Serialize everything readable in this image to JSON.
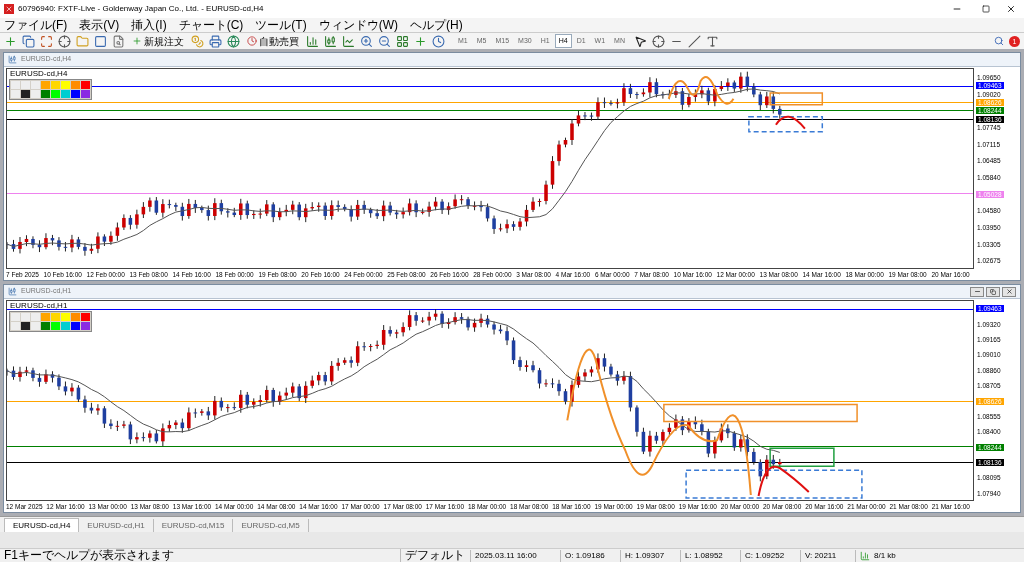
{
  "window": {
    "title": "60796940: FXTF-Live - Goldenway Japan Co., Ltd. - EURUSD-cd,H4"
  },
  "menu": [
    "ファイル(F)",
    "表示(V)",
    "挿入(I)",
    "チャート(C)",
    "ツール(T)",
    "ウィンドウ(W)",
    "ヘルプ(H)"
  ],
  "toolbar": {
    "new_order": "新規注文",
    "auto_trading": "自動売買",
    "notification_badge": "1",
    "timeframes": [
      {
        "label": "M1",
        "selected": false
      },
      {
        "label": "M5",
        "selected": false
      },
      {
        "label": "M15",
        "selected": false
      },
      {
        "label": "M30",
        "selected": false
      },
      {
        "label": "H1",
        "selected": false
      },
      {
        "label": "H4",
        "selected": true
      },
      {
        "label": "D1",
        "selected": false
      },
      {
        "label": "W1",
        "selected": false
      },
      {
        "label": "MN",
        "selected": false
      }
    ]
  },
  "charts": [
    {
      "title": "EURUSD-cd,H4",
      "symbol_label": "EURUSD-cd,H4",
      "window_controls": false,
      "price_ticks": [
        "1.09650",
        "1.09020",
        "1.07745",
        "1.07115",
        "1.06485",
        "1.05840",
        "1.04580",
        "1.03950",
        "1.03305",
        "1.02675"
      ],
      "price_tags": [
        {
          "label": "1.09463",
          "color": "#0000ff"
        },
        {
          "label": "1.08626",
          "color": "#ffa500"
        },
        {
          "label": "1.08244",
          "color": "#008000"
        },
        {
          "label": "1.08136",
          "color": "#000000"
        },
        {
          "label": "1.05028",
          "color": "#ee82ee"
        }
      ],
      "time_labels": [
        "7 Feb 2025",
        "10 Feb 16:00",
        "12 Feb 00:00",
        "13 Feb 08:00",
        "14 Feb 16:00",
        "18 Feb 00:00",
        "19 Feb 08:00",
        "20 Feb 16:00",
        "24 Feb 00:00",
        "25 Feb 08:00",
        "26 Feb 16:00",
        "28 Feb 00:00",
        "3 Mar 08:00",
        "4 Mar 16:00",
        "6 Mar 00:00",
        "7 Mar 08:00",
        "10 Mar 16:00",
        "12 Mar 00:00",
        "13 Mar 08:00",
        "14 Mar 16:00",
        "18 Mar 00:00",
        "19 Mar 08:00",
        "20 Mar 16:00"
      ]
    },
    {
      "title": "EURUSD-cd,H1",
      "symbol_label": "EURUSD-cd,H1",
      "window_controls": true,
      "price_ticks": [
        "1.09320",
        "1.09165",
        "1.09010",
        "1.08860",
        "1.08705",
        "1.08555",
        "1.08400",
        "1.08095",
        "1.07940"
      ],
      "price_tags": [
        {
          "label": "1.09463",
          "color": "#0000ff"
        },
        {
          "label": "1.08626",
          "color": "#ffa500"
        },
        {
          "label": "1.08244",
          "color": "#008000"
        },
        {
          "label": "1.08136",
          "color": "#000000"
        }
      ],
      "time_labels": [
        "12 Mar 2025",
        "12 Mar 16:00",
        "13 Mar 00:00",
        "13 Mar 08:00",
        "13 Mar 16:00",
        "14 Mar 00:00",
        "14 Mar 08:00",
        "14 Mar 16:00",
        "17 Mar 00:00",
        "17 Mar 08:00",
        "17 Mar 16:00",
        "18 Mar 00:00",
        "18 Mar 08:00",
        "18 Mar 16:00",
        "19 Mar 00:00",
        "19 Mar 08:00",
        "19 Mar 16:00",
        "20 Mar 00:00",
        "20 Mar 08:00",
        "20 Mar 16:00",
        "21 Mar 00:00",
        "21 Mar 08:00",
        "21 Mar 16:00"
      ]
    }
  ],
  "tabs": [
    {
      "label": "EURUSD-cd,H4",
      "selected": true
    },
    {
      "label": "EURUSD-cd,H1",
      "selected": false
    },
    {
      "label": "EURUSD-cd,M15",
      "selected": false
    },
    {
      "label": "EURUSD-cd,M5",
      "selected": false
    }
  ],
  "status_bar": {
    "help": "F1キーでヘルプが表示されます",
    "profile": "デフォルト",
    "time": "2025.03.11 16:00",
    "open": "O: 1.09186",
    "high": "H: 1.09307",
    "low": "L: 1.08952",
    "close": "C: 1.09252",
    "volume": "V: 20211",
    "traffic": "8/1 kb"
  }
}
